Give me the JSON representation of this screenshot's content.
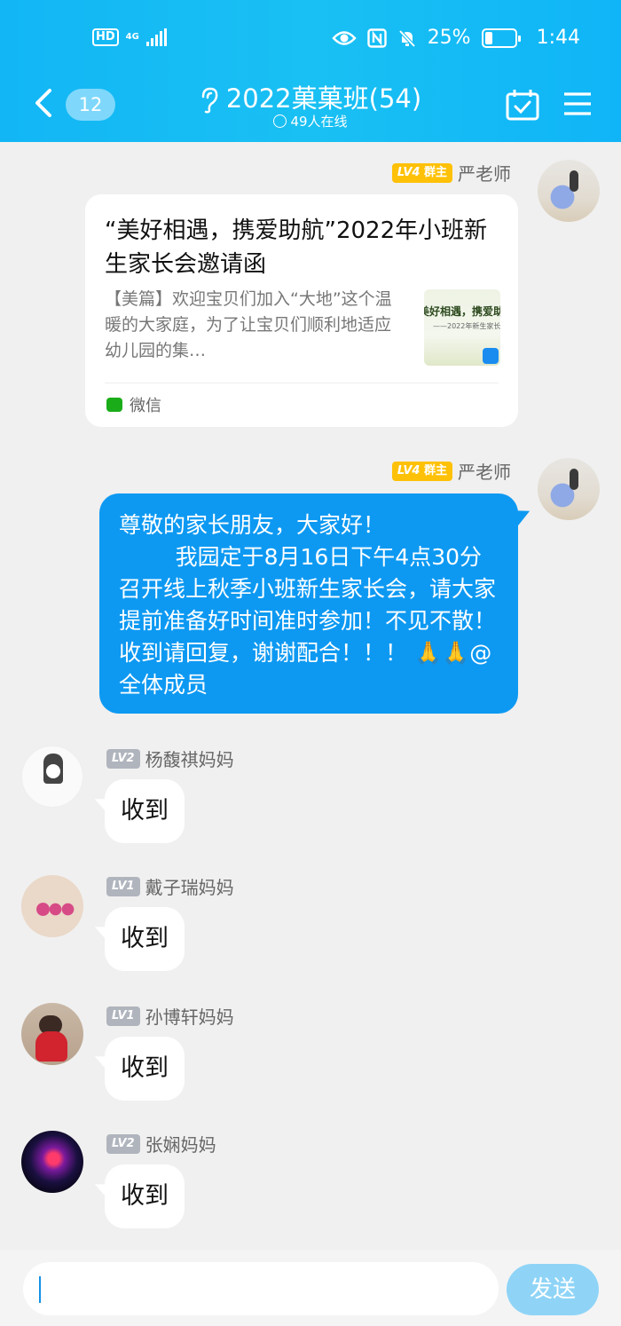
{
  "status_bar": {
    "hd": "HD",
    "network": "4G",
    "battery": "25%",
    "battery_level": 0.25,
    "time": "1:44"
  },
  "header": {
    "back_count": "12",
    "title": "2022菓菓班(54)",
    "online": "49人在线",
    "icons": [
      "back-icon",
      "ear-icon",
      "calendar-check-icon",
      "menu-icon"
    ]
  },
  "messages": [
    {
      "type": "article",
      "sender": "严老师",
      "level": "LV4",
      "role": "群主",
      "title": "“美好相遇，携爱助航”2022年小班新生家长会邀请函",
      "desc": "【美篇】欢迎宝贝们加入“大地”这个温暖的大家庭，为了让宝贝们顺利地适应幼儿园的集…",
      "thumb_title": "美好相遇，携爱助航",
      "thumb_sub": "——2022年新生家长会",
      "source": "微信"
    },
    {
      "type": "text",
      "sender": "严老师",
      "level": "LV4",
      "role": "群主",
      "text": "尊敬的家长朋友，大家好！\n        我园定于8月16日下午4点30分召开线上秋季小班新生家长会，请大家提前准备好时间准时参加！不见不散！收到请回复，谢谢配合！！！ 🙏🙏@全体成员"
    },
    {
      "type": "text",
      "sender": "杨馥祺妈妈",
      "level": "LV2",
      "text": "收到"
    },
    {
      "type": "text",
      "sender": "戴子瑞妈妈",
      "level": "LV1",
      "text": "收到"
    },
    {
      "type": "text",
      "sender": "孙博轩妈妈",
      "level": "LV1",
      "text": "收到"
    },
    {
      "type": "text",
      "sender": "张娴妈妈",
      "level": "LV2",
      "text": "收到"
    }
  ],
  "input": {
    "placeholder": "",
    "send_label": "发送"
  },
  "colors": {
    "header": "#12b6f5",
    "my_bubble": "#0d99f2",
    "send_button": "#8fd4f7"
  }
}
